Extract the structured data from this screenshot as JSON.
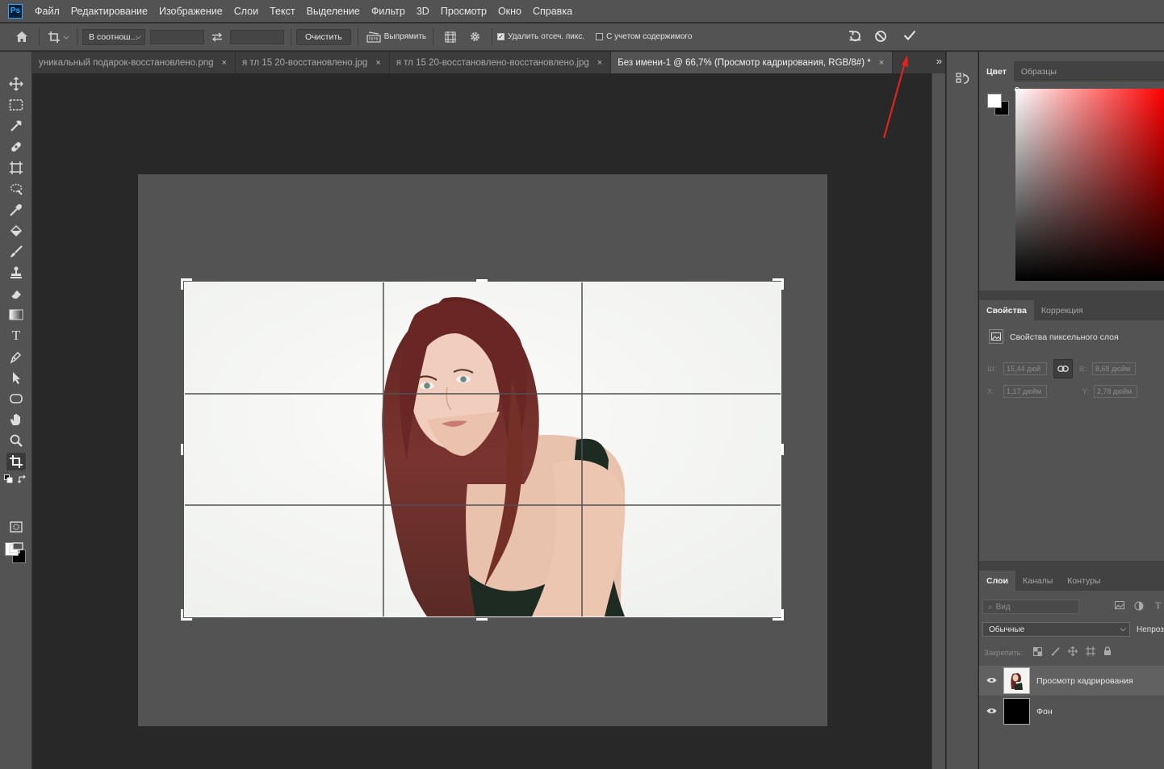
{
  "app": {
    "logo": "Ps"
  },
  "menu": [
    "Файл",
    "Редактирование",
    "Изображение",
    "Слои",
    "Текст",
    "Выделение",
    "Фильтр",
    "3D",
    "Просмотр",
    "Окно",
    "Справка"
  ],
  "options": {
    "ratio_label": "В соотнош...",
    "clear_label": "Очистить",
    "straighten_label": "Выпрямить",
    "delete_cropped_label": "Удалить отсеч. пикс.",
    "delete_cropped_checked": true,
    "content_aware_label": "С учетом содержимого",
    "content_aware_checked": false
  },
  "tabs": [
    {
      "label": "уникальный подарок-восстановлено.png",
      "active": false
    },
    {
      "label": "я тл 15 20-восстановлено.jpg",
      "active": false
    },
    {
      "label": "я тл 15 20-восстановлено-восстановлено.jpg",
      "active": false
    },
    {
      "label": "Без имени-1 @ 66,7% (Просмотр кадрирования, RGB/8#) *",
      "active": true
    }
  ],
  "tab_close_glyph": "×",
  "color_panel": {
    "tabs": [
      "Цвет",
      "Образцы"
    ]
  },
  "properties_panel": {
    "tabs": [
      "Свойства",
      "Коррекция"
    ],
    "title": "Свойства пиксельного слоя",
    "w_label": "Ш:",
    "w_value": "15,44 дюй",
    "h_label": "В:",
    "h_value": "8,68 дюйм",
    "x_label": "X:",
    "x_value": "1,17 дюйм",
    "y_label": "Y:",
    "y_value": "2,78 дюйм"
  },
  "layers_panel": {
    "tabs": [
      "Слои",
      "Каналы",
      "Контуры"
    ],
    "filter_placeholder": "Вид",
    "blend_mode": "Обычные",
    "opacity_label": "Непроз",
    "lock_label": "Закрепить:",
    "layers": [
      {
        "name": "Просмотр кадрирования",
        "selected": true
      },
      {
        "name": "Фон",
        "selected": false
      }
    ]
  },
  "colors": {
    "accent_arrow": "#e0241b",
    "panel_bg": "#535353",
    "canvas_bg": "#282828"
  }
}
